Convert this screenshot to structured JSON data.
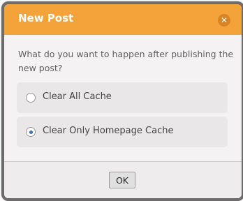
{
  "dialog": {
    "title": "New Post",
    "close_icon_glyph": "✕",
    "prompt": "What do you want to happen after publishing the new post?",
    "options": [
      {
        "label": "Clear All Cache",
        "checked": false
      },
      {
        "label": "Clear Only Homepage Cache",
        "checked": true
      }
    ],
    "ok_label": "OK"
  },
  "colors": {
    "titlebar": "#f4a23a",
    "close_button": "#d98425",
    "radio_selected": "#3a6fb0"
  },
  "icons": {
    "close": "close-icon"
  }
}
